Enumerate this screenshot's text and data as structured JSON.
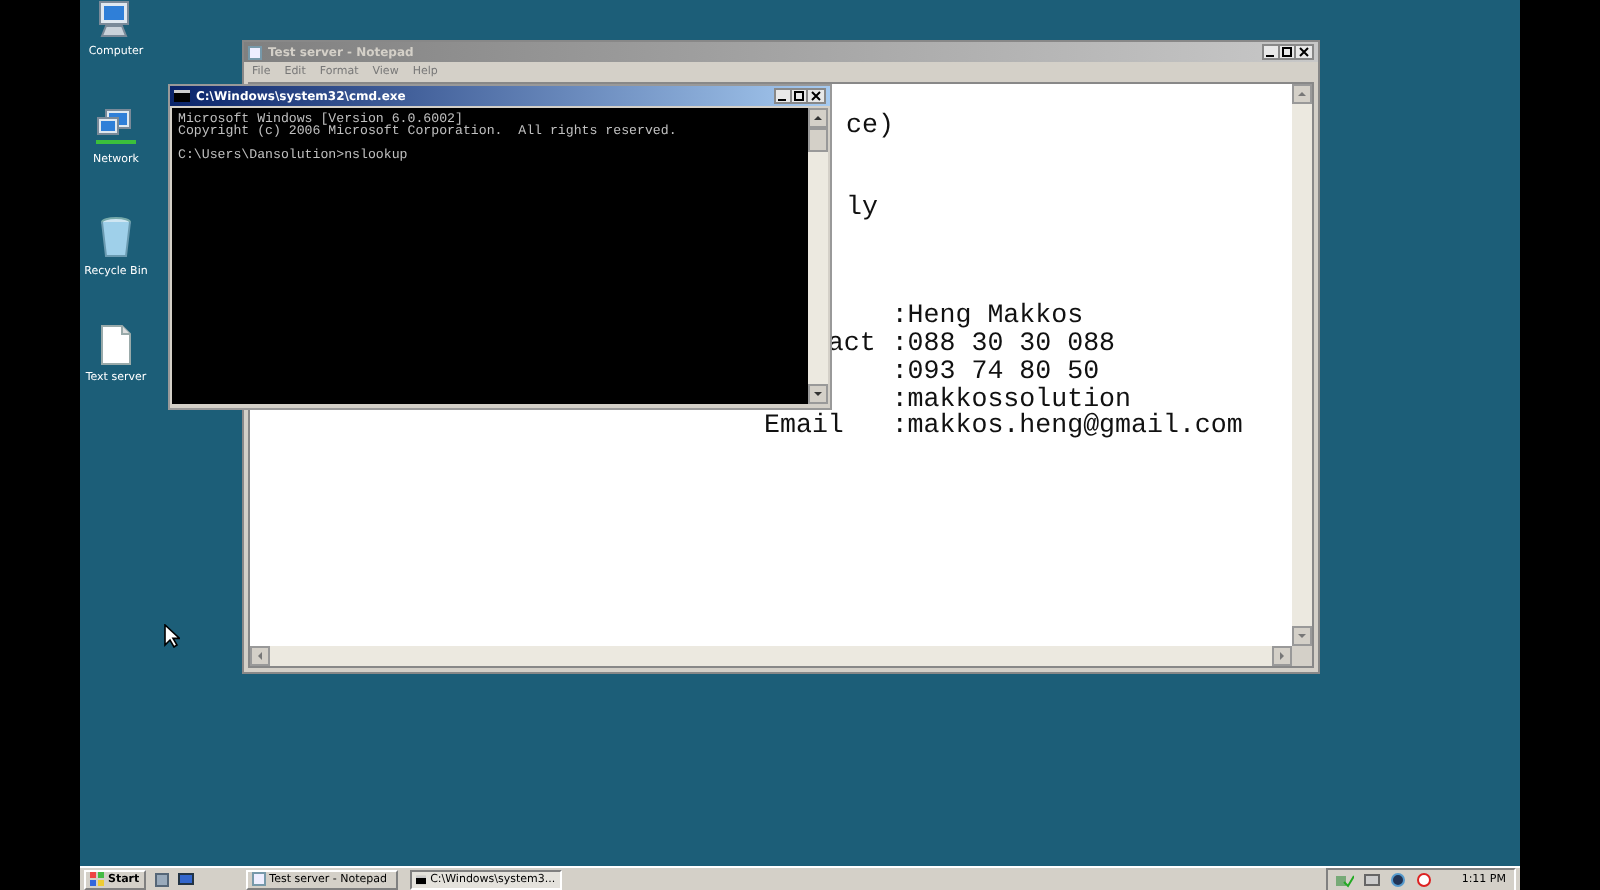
{
  "desktop": {
    "icons": [
      {
        "kind": "computer",
        "label": "Computer"
      },
      {
        "kind": "network",
        "label": "Network"
      },
      {
        "kind": "recycle-bin",
        "label": "Recycle Bin"
      },
      {
        "kind": "document",
        "label": "Text server"
      }
    ]
  },
  "notepad": {
    "title": "Test server - Notepad",
    "active": false,
    "menu": [
      "File",
      "Edit",
      "Format",
      "View",
      "Help"
    ],
    "fragments": [
      "ce)",
      "ly"
    ],
    "rows": [
      {
        "value": ":Heng Makkos"
      },
      {
        "label": "act",
        "clipped": true,
        "value": ":088 30 30 088"
      },
      {
        "value": ":093 74 80 50"
      },
      {
        "value": ":makkossolution"
      },
      {
        "label": "Email",
        "value": ":makkos.heng@gmail.com"
      }
    ]
  },
  "cmd": {
    "title": "C:\\Windows\\system32\\cmd.exe",
    "active": true,
    "output": [
      "Microsoft Windows [Version 6.0.6002]",
      "Copyright (c) 2006 Microsoft Corporation.  All rights reserved."
    ],
    "prompt": "C:\\Users\\Dansolution>nslookup"
  },
  "taskbar": {
    "start": "Start",
    "tasks": [
      {
        "kind": "notepad",
        "label": "Test server - Notepad",
        "selected": false
      },
      {
        "kind": "console",
        "label": "C:\\Windows\\system3...",
        "selected": true
      }
    ],
    "clock": "1:11 PM"
  }
}
